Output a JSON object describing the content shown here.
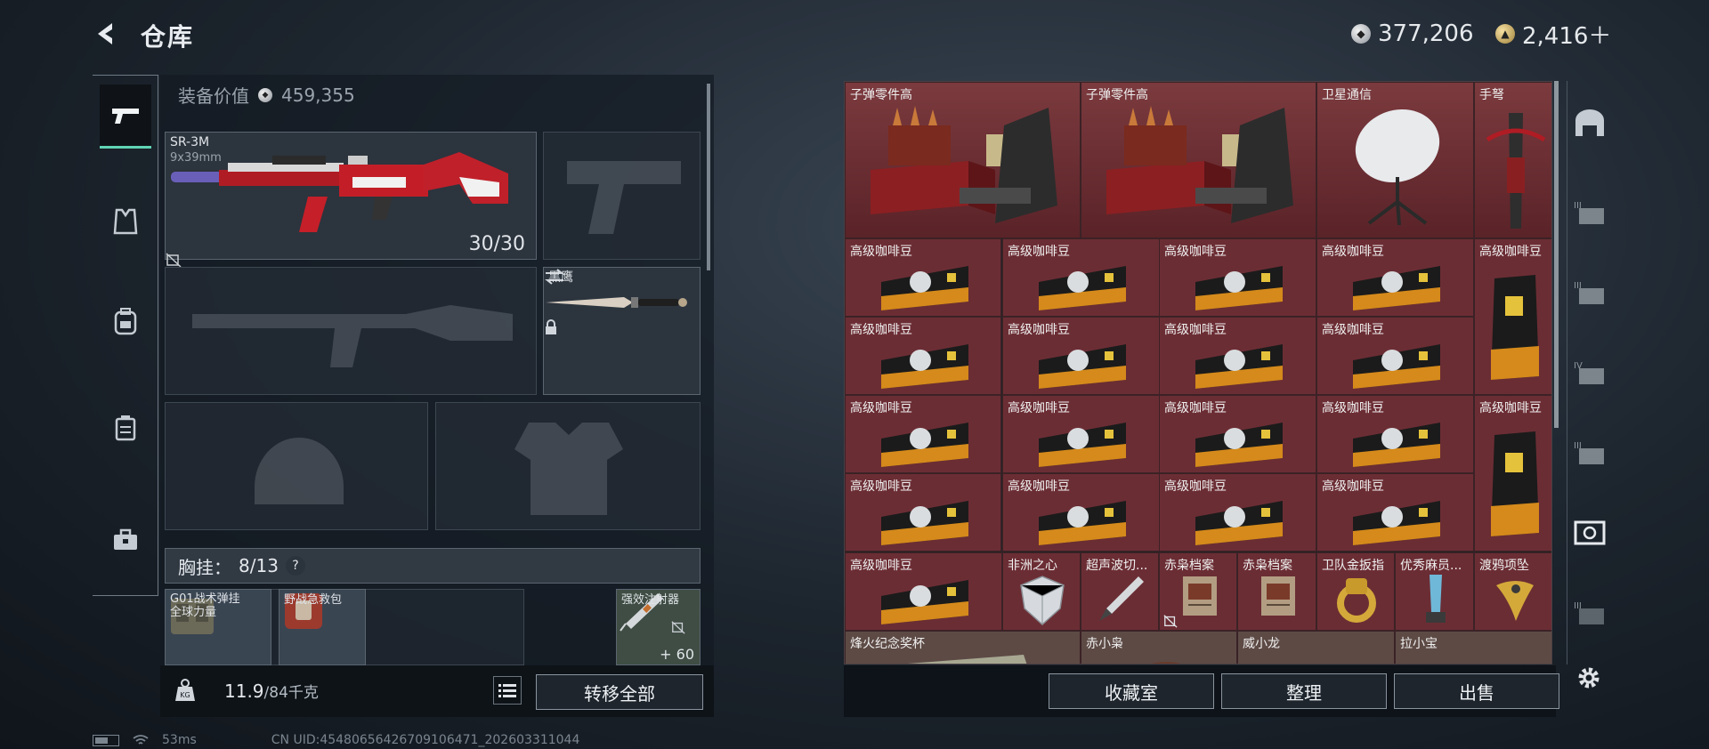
{
  "header": {
    "title": "仓库",
    "currency_silver": "377,206",
    "currency_gold": "2,416＋"
  },
  "left_panel": {
    "equip_value_label": "装备价值",
    "equip_value": "459,355",
    "primary_weapon": {
      "name": "SR-3M",
      "caliber": "9x39mm",
      "ammo": "30/30"
    },
    "melee": {
      "name": "黑鹰"
    },
    "chest_rig": {
      "label": "胸挂：",
      "capacity": "8/13",
      "help": "?"
    },
    "items": [
      {
        "name": "G01战术弹挂\n全球力量"
      },
      {
        "name": "野战急救包"
      },
      {
        "name": "强效注射器",
        "count": "+ 60"
      }
    ],
    "weight": "11.9",
    "weight_max": "/84千克",
    "transfer_all": "转移全部"
  },
  "grid": {
    "items": [
      {
        "name": "子弹零件高"
      },
      {
        "name": "子弹零件高"
      },
      {
        "name": "卫星通信"
      },
      {
        "name": "手弩"
      },
      {
        "name": "高级咖啡豆"
      },
      {
        "name": "非洲之心"
      },
      {
        "name": "超声波切..."
      },
      {
        "name": "赤枭档案"
      },
      {
        "name": "卫队金扳指"
      },
      {
        "name": "优秀麻员..."
      },
      {
        "name": "渡鸦项坠"
      },
      {
        "name": "烽火纪念奖杯"
      },
      {
        "name": "赤小枭"
      },
      {
        "name": "威小龙"
      },
      {
        "name": "拉小宝"
      }
    ],
    "buttons": {
      "collection": "收藏室",
      "sort": "整理",
      "sell": "出售"
    }
  },
  "status_bar": {
    "ping": "53ms",
    "uid": "CN UID:45480656426709106471_202603311044"
  }
}
